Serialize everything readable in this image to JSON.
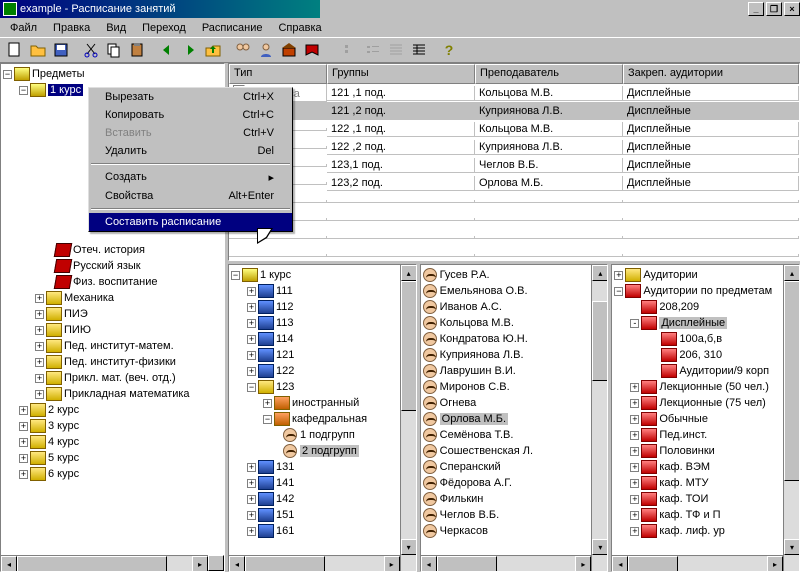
{
  "title": "example - Расписание занятий",
  "menubar": [
    "Файл",
    "Правка",
    "Вид",
    "Переход",
    "Расписание",
    "Справка"
  ],
  "context_menu": [
    {
      "label": "Вырезать",
      "shortcut": "Ctrl+X",
      "disabled": false
    },
    {
      "label": "Копировать",
      "shortcut": "Ctrl+C",
      "disabled": false
    },
    {
      "label": "Вставить",
      "shortcut": "Ctrl+V",
      "disabled": true
    },
    {
      "label": "Удалить",
      "shortcut": "Del",
      "disabled": false
    },
    {
      "sep": true
    },
    {
      "label": "Создать",
      "arrow": true,
      "disabled": false
    },
    {
      "label": "Свойства",
      "shortcut": "Alt+Enter",
      "disabled": false
    },
    {
      "sep": true
    },
    {
      "label": "Составить расписание",
      "highlight": true
    }
  ],
  "left_tree": {
    "root": "Предметы",
    "course": "1 курс",
    "items_level2": [
      "Отеч. история",
      "Русский язык",
      "Физ. воспитание"
    ],
    "courses2": [
      {
        "exp": "+",
        "label": "Механика"
      },
      {
        "exp": "+",
        "label": "ПИЭ"
      },
      {
        "exp": "+",
        "label": "ПИЮ"
      },
      {
        "exp": "+",
        "label": "Пед. институт-матем."
      },
      {
        "exp": "+",
        "label": "Пед. институт-физики"
      },
      {
        "exp": "+",
        "label": "Прикл. мат. (веч. отд.)"
      },
      {
        "exp": "+",
        "label": "Прикладная математика"
      }
    ],
    "other_courses": [
      "2 курс",
      "3 курс",
      "4 курс",
      "5 курс",
      "6 курс"
    ]
  },
  "grid": {
    "headers": [
      "Тип",
      "Группы",
      "Преподаватель",
      "Закреп. аудитории"
    ],
    "widths": [
      98,
      148,
      148,
      170
    ],
    "rows": [
      {
        "group": "121 ,1 под.",
        "teacher": "Кольцова М.В.",
        "aud": "Дисплейные",
        "sel": false
      },
      {
        "group": "121 ,2 под.",
        "teacher": "Куприянова Л.В.",
        "aud": "Дисплейные",
        "sel": true
      },
      {
        "group": "122 ,1 под.",
        "teacher": "Кольцова М.В.",
        "aud": "Дисплейные",
        "sel": false
      },
      {
        "group": "122 ,2 под.",
        "teacher": "Куприянова Л.В.",
        "aud": "Дисплейные",
        "sel": false
      },
      {
        "group": "123,1 под.",
        "teacher": "Чеглов В.Б.",
        "aud": "Дисплейные",
        "sel": false
      },
      {
        "group": "123,2 под.",
        "teacher": "Орлова М.Б.",
        "aud": "Дисплейные",
        "sel": false
      }
    ],
    "first_row_label": "ПР. 3 часа"
  },
  "panel2": {
    "root": "1 курс",
    "groups": [
      "111",
      "112",
      "113",
      "114",
      "121",
      "122",
      "123"
    ],
    "sub123": {
      "a": "иностранный",
      "b": "кафедральная",
      "b1": "1 подгрупп",
      "b2": "2 подгрупп"
    },
    "more": [
      "131",
      "141",
      "142",
      "151",
      "161"
    ]
  },
  "panel3": {
    "people": [
      "Гусев Р.А.",
      "Емельянова О.В.",
      "Иванов А.С.",
      "Кольцова М.В.",
      "Кондратова Ю.Н.",
      "Куприянова Л.В.",
      "Лаврушин В.И.",
      "Миронов С.В.",
      "Огнева",
      "Орлова М.Б.",
      "Семёнова Т.В.",
      "Сошественская Л.",
      "Сперанский",
      "Фёдорова А.Г.",
      "Филькин",
      "Чеглов В.Б.",
      "Черкасов"
    ],
    "selected": "Орлова М.Б."
  },
  "panel4": {
    "root": "Аудитории",
    "sub": "Аудитории по предметам",
    "items": [
      {
        "label": "208,209",
        "exp": ""
      },
      {
        "label": "Дисплейные",
        "exp": "-",
        "sel": true,
        "children": [
          "100а,б,в",
          "206, 310",
          "Аудитории/9 корп"
        ]
      },
      {
        "label": "Лекционные (50 чел.)",
        "exp": "+"
      },
      {
        "label": "Лекционные (75 чел)",
        "exp": "+"
      },
      {
        "label": "Обычные",
        "exp": "+"
      },
      {
        "label": "Пед.инст.",
        "exp": "+"
      },
      {
        "label": "Половинки",
        "exp": "+"
      },
      {
        "label": "каф. ВЭМ",
        "exp": "+"
      },
      {
        "label": "каф. МТУ",
        "exp": "+"
      },
      {
        "label": "каф. ТОИ",
        "exp": "+"
      },
      {
        "label": "каф. ТФ и П",
        "exp": "+"
      },
      {
        "label": "каф. лиф. ур",
        "exp": "+"
      }
    ]
  }
}
